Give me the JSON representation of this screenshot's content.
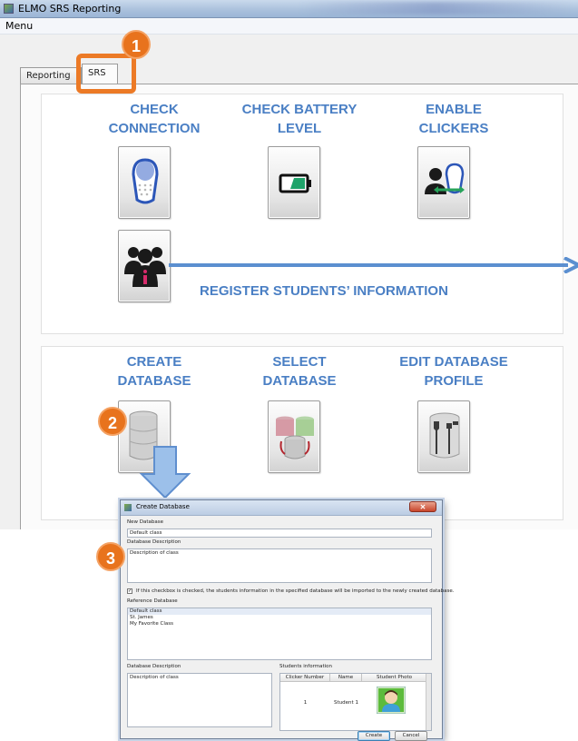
{
  "window": {
    "title": "ELMO SRS Reporting"
  },
  "menubar": {
    "menu": "Menu"
  },
  "tabs": [
    "Reporting",
    "SRS"
  ],
  "srs": {
    "check_connection": "CHECK\nCONNECTION",
    "check_battery": "CHECK BATTERY\nLEVEL",
    "enable_clickers": "ENABLE\nCLICKERS",
    "register_students": "REGISTER STUDENTS’ INFORMATION",
    "create_database": "CREATE\nDATABASE",
    "select_database": "SELECT\nDATABASE",
    "edit_profile": "EDIT DATABASE\nPROFILE"
  },
  "steps": [
    "1",
    "2",
    "3"
  ],
  "colors": {
    "label_blue": "#4a7fc4",
    "step_orange": "#e8731d",
    "arrow_blue": "#5b8fd0"
  },
  "dialog": {
    "title": "Create Database",
    "new_database_label": "New Database",
    "new_database_value": "Default class",
    "database_description_label": "Database Description",
    "database_description_value": "Description of class",
    "import_checkbox_checked": true,
    "import_checkbox_text": "If this checkbox is checked, the students information in the specified database will be imported to the newly created database.",
    "reference_database_label": "Reference Database",
    "reference_databases": [
      "Default class",
      "St. James",
      "My Favorite Class"
    ],
    "ref_description_label": "Database Description",
    "ref_description_value": "Description of class",
    "students_info_label": "Students information",
    "students_columns": [
      "Clicker Number",
      "Name",
      "Student Photo"
    ],
    "students_rows": [
      {
        "clicker": "1",
        "name": "Student 1"
      }
    ],
    "create_button": "Create",
    "cancel_button": "Cancel"
  }
}
